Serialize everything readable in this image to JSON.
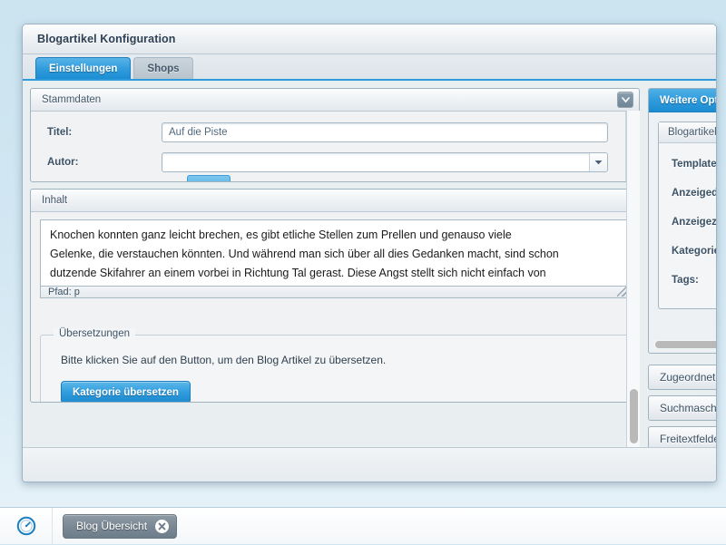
{
  "window": {
    "title": "Blogartikel Konfiguration",
    "tabs": [
      {
        "label": "Einstellungen",
        "active": true
      },
      {
        "label": "Shops",
        "active": false
      }
    ]
  },
  "stammdaten": {
    "panel_title": "Stammdaten",
    "collapse_icon": "chevron-down-icon",
    "fields": [
      {
        "label": "Titel:",
        "value": "Auf die Piste",
        "type": "text"
      },
      {
        "label": "Autor:",
        "value": "",
        "type": "combobox"
      }
    ]
  },
  "inhalt": {
    "panel_title": "Inhalt",
    "editor_lines": [
      "Knochen konnten ganz leicht brechen, es gibt etliche Stellen zum Prellen und genauso viele",
      "Gelenke, die verstauchen könnten. Und während man sich über all dies Gedanken macht, sind schon",
      "dutzende Skifahrer an einem vorbei in Richtung Tal gerast. Diese Angst stellt sich nicht einfach von"
    ],
    "status_text": "Pfad: p",
    "resize_handle": "resize-grip-icon"
  },
  "uebersetzungen": {
    "legend": "Übersetzungen",
    "description": "Bitte klicken Sie auf den Button, um den Blog Artikel zu übersetzen.",
    "button_label": "Kategorie übersetzen"
  },
  "sidebar": {
    "active_accordion": {
      "title": "Weitere Optionen",
      "inner_panel_title": "Blogartikel-Eigenschaften",
      "properties": [
        {
          "label": "Template:"
        },
        {
          "label": "Anzeigedatum:"
        },
        {
          "label": "Anzeigezeit:"
        },
        {
          "label": "Kategorie:"
        },
        {
          "label": "Tags:"
        }
      ]
    },
    "collapsed_accordions": [
      {
        "label": "Zugeordnete Artikel"
      },
      {
        "label": "Suchmaschinen Optimierung"
      },
      {
        "label": "Freitextfelder"
      }
    ]
  },
  "taskbar": {
    "start_icon": "dashboard-gauge-icon",
    "tasks": [
      {
        "label": "Blog Übersicht",
        "close_icon": "close-icon"
      }
    ]
  },
  "colors": {
    "accent_blue": "#2e9bdc",
    "desktop_bg": "#cfe6f1",
    "panel_bg": "#f0f2f4",
    "border": "#9fb2c0",
    "label_text": "#3c5266"
  }
}
